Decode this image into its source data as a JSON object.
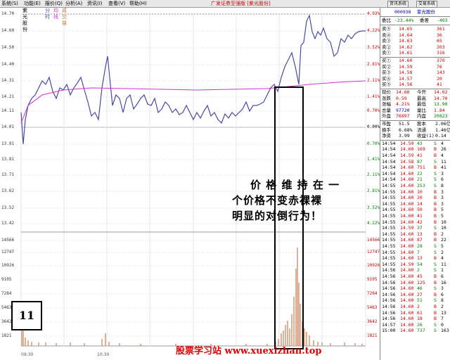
{
  "menu": [
    "系统(S)",
    "功能(E)",
    "报价(Q)",
    "分析(A)",
    "资讯(I)",
    "查看(V)",
    "帮助(H)"
  ],
  "app_title": "广发证券至强版 [紫光股份]",
  "toolbar_buttons": [
    "资讯系统",
    "交易系统"
  ],
  "chart_header": {
    "name": "紫光股份",
    "tab1": "分时",
    "tab2": "均线",
    "tab3": "成交量"
  },
  "left_ticks": [
    "14.70",
    "14.60",
    "14.50",
    "14.40",
    "14.31",
    "14.21",
    "14.11",
    "14.01",
    "13.91",
    "13.81",
    "13.71",
    "13.62",
    "13.52",
    "13.42",
    "14566",
    "12747",
    "10926",
    "9105",
    "7284",
    "5463",
    "3642",
    "1821"
  ],
  "right_ticks": [
    "4.93%",
    "4.22%",
    "3.52%",
    "2.81%",
    "2.11%",
    "1.41%",
    "0.70%",
    "0.00%",
    "0.70%",
    "1.41%",
    "2.11%",
    "2.81%",
    "3.52%",
    "4.22%",
    "14566",
    "12747",
    "10926",
    "9105",
    "7284",
    "5463",
    "3642",
    "1821"
  ],
  "time_labels": [
    "09:30",
    "10:30"
  ],
  "stock": {
    "code": "000938",
    "name": "紫光股份"
  },
  "ratio": {
    "label": "委比",
    "value": "-23.44%",
    "diff_label": "委差",
    "diff": "-403"
  },
  "sell": [
    {
      "label": "卖⑤",
      "price": "14.65",
      "vol": "361"
    },
    {
      "label": "卖④",
      "price": "14.64",
      "vol": "36"
    },
    {
      "label": "卖③",
      "price": "14.63",
      "vol": "65"
    },
    {
      "label": "卖②",
      "price": "14.62",
      "vol": "203"
    },
    {
      "label": "卖①",
      "price": "14.61",
      "vol": "316"
    }
  ],
  "buy": [
    {
      "label": "买①",
      "price": "14.60",
      "vol": "370"
    },
    {
      "label": "买②",
      "price": "14.59",
      "vol": "76"
    },
    {
      "label": "买③",
      "price": "14.58",
      "vol": "143"
    },
    {
      "label": "买④",
      "price": "14.57",
      "vol": "20"
    },
    {
      "label": "买⑤",
      "price": "14.56",
      "vol": "41"
    }
  ],
  "quote": [
    [
      "现价",
      "14.60",
      "今开",
      "14.02"
    ],
    [
      "涨跌",
      "0.59",
      "最高",
      "14.70"
    ],
    [
      "涨幅",
      "4.21%",
      "最低",
      "13.90"
    ],
    [
      "总量",
      "97720",
      "量比",
      "1.84"
    ],
    [
      "外盘",
      "76897",
      "内盘",
      "20823"
    ]
  ],
  "fund": [
    [
      "市盈",
      "51.5",
      "股本",
      "2.06亿"
    ],
    [
      "换手",
      "6.68%",
      "流通",
      "1.46亿"
    ],
    [
      "净资",
      "3.99",
      "收益(1)",
      "0.14"
    ]
  ],
  "ticks": [
    [
      "14:54",
      "14.59",
      "43",
      "S",
      "4"
    ],
    [
      "14:54",
      "14.60",
      "169",
      "B",
      "26"
    ],
    [
      "14:54",
      "14.59",
      "41",
      "B",
      "4"
    ],
    [
      "14:54",
      "14.58",
      "87",
      "S",
      "11"
    ],
    [
      "14:54",
      "14.60",
      "751",
      "B",
      "41"
    ],
    [
      "14:54",
      "14.60",
      "22",
      "S",
      "3"
    ],
    [
      "14:54",
      "14.60",
      "21",
      "S",
      "6"
    ],
    [
      "14:55",
      "14.60",
      "253",
      "S",
      "8"
    ],
    [
      "14:55",
      "14.60",
      "10",
      "B",
      "3"
    ],
    [
      "14:55",
      "14.60",
      "20",
      "B",
      "3"
    ],
    [
      "14:55",
      "14.60",
      "14",
      "B",
      "3"
    ],
    [
      "14:55",
      "14.60",
      "50",
      "B",
      "5"
    ],
    [
      "14:55",
      "14.60",
      "41",
      "B",
      "5"
    ],
    [
      "14:55",
      "14.60",
      "42",
      "B",
      "10"
    ],
    [
      "14:55",
      "14.59",
      "37",
      "S",
      "10"
    ],
    [
      "14:55",
      "14.60",
      "13",
      "B",
      "2"
    ],
    [
      "14:55",
      "14.60",
      "87",
      "B",
      "22"
    ],
    [
      "14:55",
      "14.60",
      "28",
      "S",
      "5"
    ],
    [
      "14:55",
      "14.60",
      "7",
      "S",
      "2"
    ],
    [
      "14:55",
      "14.60",
      "13",
      "B",
      "4"
    ],
    [
      "14:55",
      "14.59",
      "54",
      "S",
      "11"
    ],
    [
      "14:56",
      "14.60",
      "2",
      "S",
      "1"
    ],
    [
      "14:56",
      "14.60",
      "45",
      "B",
      "6"
    ],
    [
      "14:56",
      "14.60",
      "125",
      "B",
      "16"
    ],
    [
      "14:56",
      "14.60",
      "46",
      "S",
      "3"
    ],
    [
      "14:56",
      "14.60",
      "27",
      "B",
      "6"
    ],
    [
      "14:56",
      "14.60",
      "51",
      "S",
      "8"
    ],
    [
      "14:56",
      "14.60",
      "2",
      "B",
      "2"
    ],
    [
      "14:56",
      "14.60",
      "61",
      "B",
      "13"
    ],
    [
      "14:56",
      "14.60",
      "18",
      "B",
      "7"
    ],
    [
      "14:57",
      "14.60",
      "26",
      "S",
      "0"
    ],
    [
      "15:00",
      "14.60",
      "737",
      "S",
      "163"
    ]
  ],
  "annotation": [
    "价 格 维 持 在 一",
    "个价格不变赤裸裸",
    "明显的对倒行为！"
  ],
  "page_badge": "11",
  "watermark": "股票学习站   www.xuexizhan.top",
  "colors": {
    "price_line": "#4a4aa0",
    "avg_line": "#cc33cc",
    "up": "#d00000",
    "down": "#008000",
    "volume": "#d09070"
  }
}
